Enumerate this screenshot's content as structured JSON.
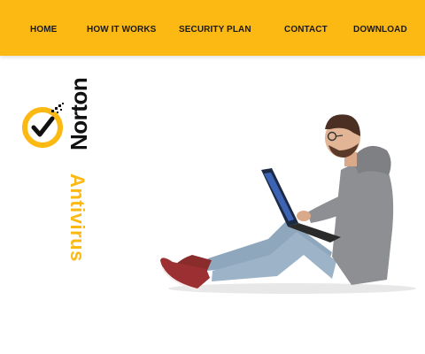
{
  "nav": {
    "items": [
      {
        "label": "HOME"
      },
      {
        "label": "HOW IT WORKS"
      },
      {
        "label": "SECURITY PLAN"
      },
      {
        "label": "CONTACT"
      },
      {
        "label": "DOWNLOAD"
      }
    ]
  },
  "logo": {
    "brand": "Norton",
    "product": "Antivirus",
    "icon": "checkmark-seal-icon"
  },
  "hero": {
    "image": "man-with-laptop-illustration"
  },
  "colors": {
    "brand_yellow": "#fdb913",
    "text_dark": "#1a1a1a",
    "background": "#ffffff"
  }
}
